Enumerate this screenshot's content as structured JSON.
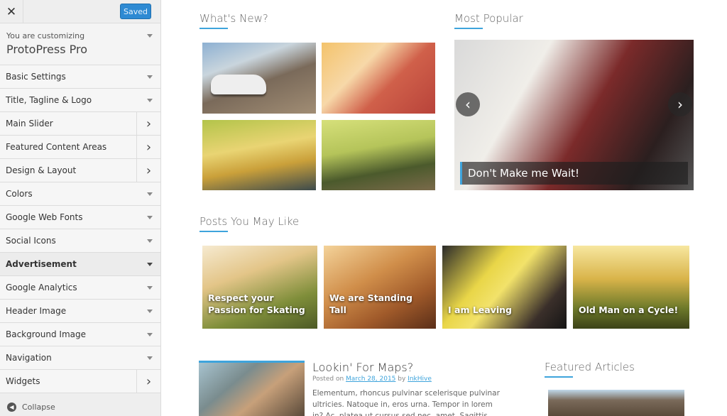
{
  "sidebar": {
    "close_icon": "close-icon",
    "saved_label": "Saved",
    "customizing_label": "You are customizing",
    "theme_name": "ProtoPress Pro",
    "items": [
      {
        "label": "Basic Settings",
        "type": "dropdown"
      },
      {
        "label": "Title, Tagline & Logo",
        "type": "dropdown"
      },
      {
        "label": "Main Slider",
        "type": "panel"
      },
      {
        "label": "Featured Content Areas",
        "type": "panel"
      },
      {
        "label": "Design & Layout",
        "type": "panel"
      },
      {
        "label": "Colors",
        "type": "dropdown"
      },
      {
        "label": "Google Web Fonts",
        "type": "dropdown"
      },
      {
        "label": "Social Icons",
        "type": "dropdown"
      },
      {
        "label": "Advertisement",
        "type": "dropdown",
        "active": true
      },
      {
        "label": "Google Analytics",
        "type": "dropdown"
      },
      {
        "label": "Header Image",
        "type": "dropdown"
      },
      {
        "label": "Background Image",
        "type": "dropdown"
      },
      {
        "label": "Navigation",
        "type": "dropdown"
      },
      {
        "label": "Widgets",
        "type": "panel"
      }
    ],
    "collapse_label": "Collapse"
  },
  "main": {
    "whats_new_heading": "What's New?",
    "most_popular_heading": "Most Popular",
    "slider_caption": "Don't Make me Wait!",
    "posts_heading": "Posts You May Like",
    "posts": [
      {
        "title": "Respect your Passion for Skating"
      },
      {
        "title": "We are Standing Tall"
      },
      {
        "title": "I am Leaving"
      },
      {
        "title": "Old Man on a Cycle!"
      }
    ],
    "article": {
      "title": "Lookin' For Maps?",
      "posted_on": "Posted on",
      "date": "March 28, 2015",
      "by": "by",
      "author": "InkHive",
      "excerpt": "Elementum, rhoncus pulvinar scelerisque pulvinar ultricies. Natoque in, eros urna. Tempor in lorem in? Ac, platea ut cursus sed nec, amet. Sagittis porttitor ut"
    },
    "featured_heading": "Featured Articles"
  },
  "colors": {
    "accent": "#3ea4dc",
    "saved_button": "#2e8ad3"
  }
}
